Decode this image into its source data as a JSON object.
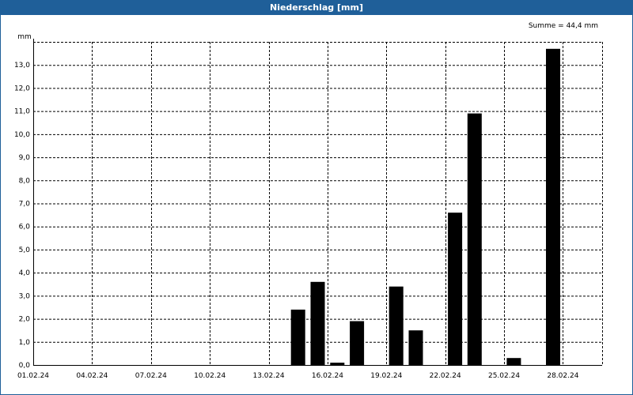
{
  "window": {
    "title": "Niederschlag [mm]"
  },
  "chart_data": {
    "type": "bar",
    "unit_label": "mm",
    "summary": "Summe = 44,4 mm",
    "y_ticks": [
      "0,0",
      "1,0",
      "2,0",
      "3,0",
      "4,0",
      "5,0",
      "6,0",
      "7,0",
      "8,0",
      "9,0",
      "10,0",
      "11,0",
      "12,0",
      "13,0"
    ],
    "ylim": [
      0,
      14
    ],
    "x_tick_labels": [
      "01.02.24",
      "04.02.24",
      "07.02.24",
      "10.02.24",
      "13.02.24",
      "16.02.24",
      "19.02.24",
      "22.02.24",
      "25.02.24",
      "28.02.24"
    ],
    "x_range_days": [
      0,
      29
    ],
    "grid": true,
    "bar_color": "#000000",
    "bars": [
      {
        "date": "14.02.24",
        "value": 2.4
      },
      {
        "date": "15.02.24",
        "value": 3.6
      },
      {
        "date": "16.02.24",
        "value": 0.1
      },
      {
        "date": "17.02.24",
        "value": 1.9
      },
      {
        "date": "19.02.24",
        "value": 3.4
      },
      {
        "date": "20.02.24",
        "value": 1.5
      },
      {
        "date": "22.02.24",
        "value": 6.6
      },
      {
        "date": "23.02.24",
        "value": 10.9
      },
      {
        "date": "25.02.24",
        "value": 0.3
      },
      {
        "date": "27.02.24",
        "value": 13.7
      }
    ]
  }
}
